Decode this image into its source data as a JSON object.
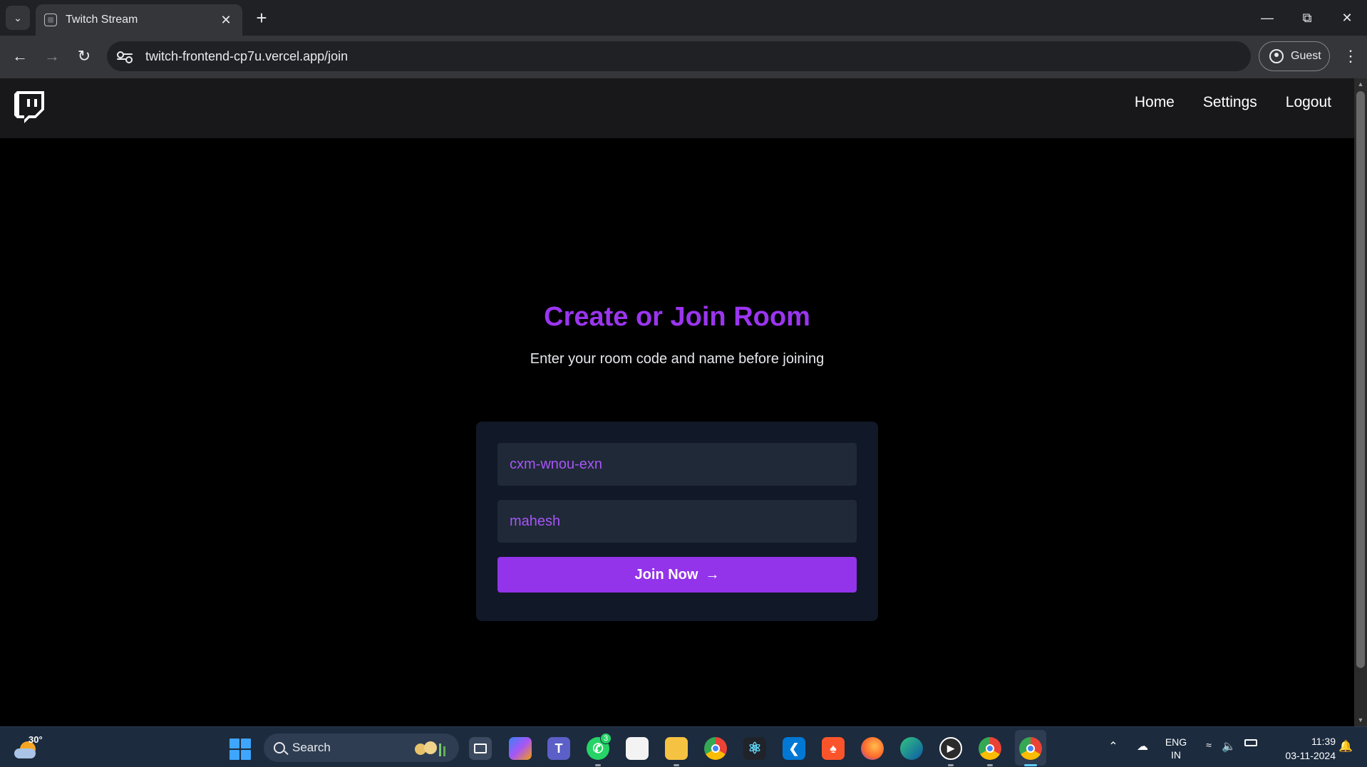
{
  "browser": {
    "tab_title": "Twitch Stream",
    "url": "twitch-frontend-cp7u.vercel.app/join",
    "profile_label": "Guest"
  },
  "navbar": {
    "links": [
      "Home",
      "Settings",
      "Logout"
    ]
  },
  "main": {
    "title": "Create or Join Room",
    "subtitle": "Enter your room code and name before joining",
    "room_code_value": "cxm-wnou-exn",
    "name_value": "mahesh",
    "join_label": "Join Now",
    "join_arrow": "→"
  },
  "taskbar": {
    "weather_temp": "30°",
    "search_label": "Search",
    "whatsapp_badge": "3",
    "lang_top": "ENG",
    "lang_bottom": "IN",
    "time": "11:39",
    "date": "03-11-2024"
  },
  "colors": {
    "accent": "#9333ea",
    "title": "#9b35f0",
    "input_text": "#a855f7",
    "card_bg": "#111827",
    "input_bg": "#1f2937",
    "navbar_bg": "#18181b"
  }
}
